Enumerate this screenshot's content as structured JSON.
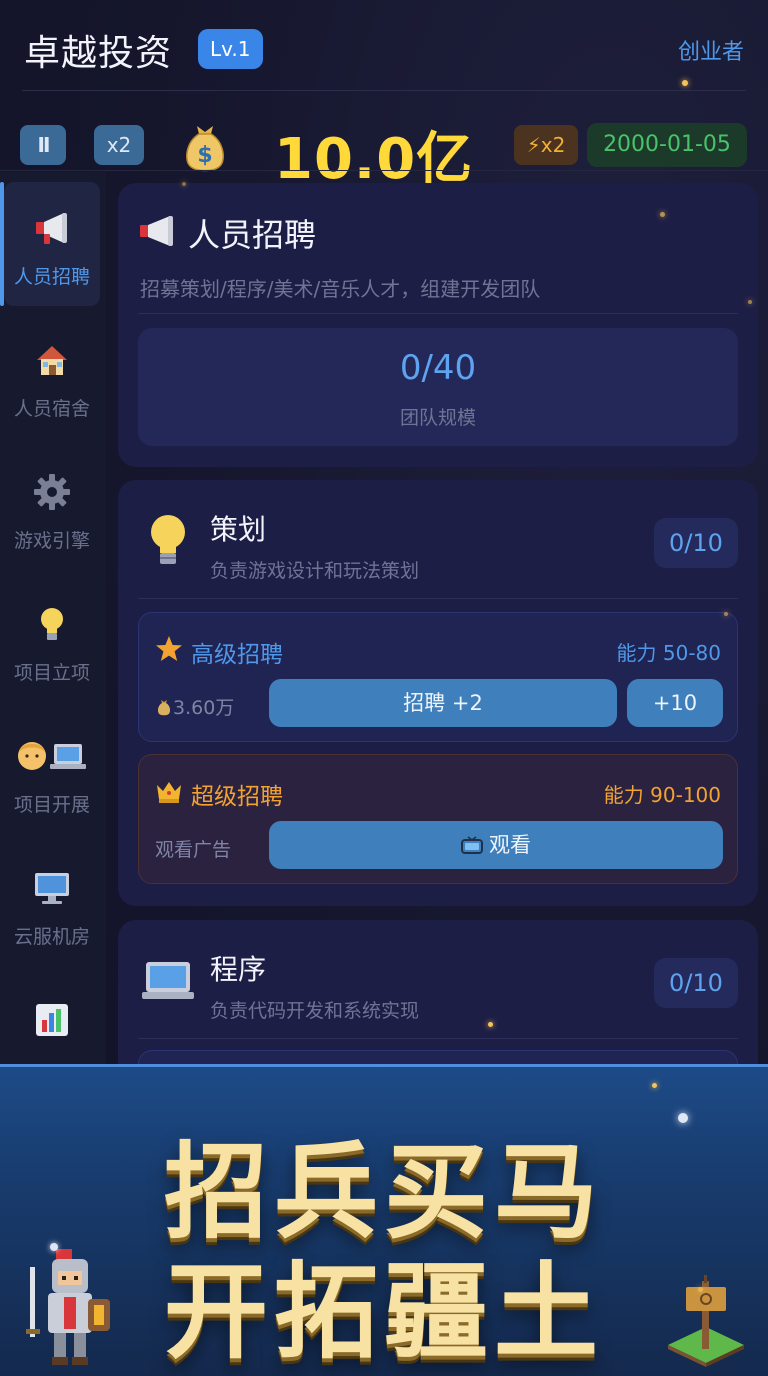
{
  "header": {
    "company_name": "卓越投资",
    "level_badge": "Lv.1",
    "role_title": "创业者"
  },
  "status": {
    "pause_label": "II",
    "speed_label": "x2",
    "money": "10.0亿",
    "boost_label": "⚡x2",
    "date": "2000-01-05"
  },
  "sidebar": {
    "items": [
      {
        "label": "人员招聘",
        "icon": "megaphone-icon",
        "active": true
      },
      {
        "label": "人员宿舍",
        "icon": "house-icon",
        "active": false
      },
      {
        "label": "游戏引擎",
        "icon": "gear-icon",
        "active": false
      },
      {
        "label": "项目立项",
        "icon": "lightbulb-icon",
        "active": false
      },
      {
        "label": "项目开展",
        "icon": "developer-laptop-icon",
        "active": false
      },
      {
        "label": "云服机房",
        "icon": "computer-icon",
        "active": false
      },
      {
        "label": "",
        "icon": "chart-icon",
        "active": false
      }
    ]
  },
  "recruitment": {
    "title": "人员招聘",
    "subtitle": "招募策划/程序/美术/音乐人才，组建开发团队",
    "team_count": "0/40",
    "team_label": "团队规模"
  },
  "roles": [
    {
      "name": "策划",
      "description": "负责游戏设计和玩法策划",
      "count": "0/10",
      "senior": {
        "title": "高级招聘",
        "ability": "能力 50-80",
        "cost": "3.60万",
        "hire_label": "招聘 +2",
        "hire_ten_label": "+10"
      },
      "super": {
        "title": "超级招聘",
        "ability": "能力 90-100",
        "cost_label": "观看广告",
        "watch_label": "观看"
      }
    },
    {
      "name": "程序",
      "description": "负责代码开发和系统实现",
      "count": "0/10"
    }
  ],
  "banner": {
    "line1": "招兵买马",
    "line2": "开拓疆土"
  },
  "colors": {
    "accent_blue": "#4f97e9",
    "gold": "#ffd83a",
    "orange": "#f2a231",
    "green": "#49c26a",
    "card_bg": "#1d1e45"
  }
}
